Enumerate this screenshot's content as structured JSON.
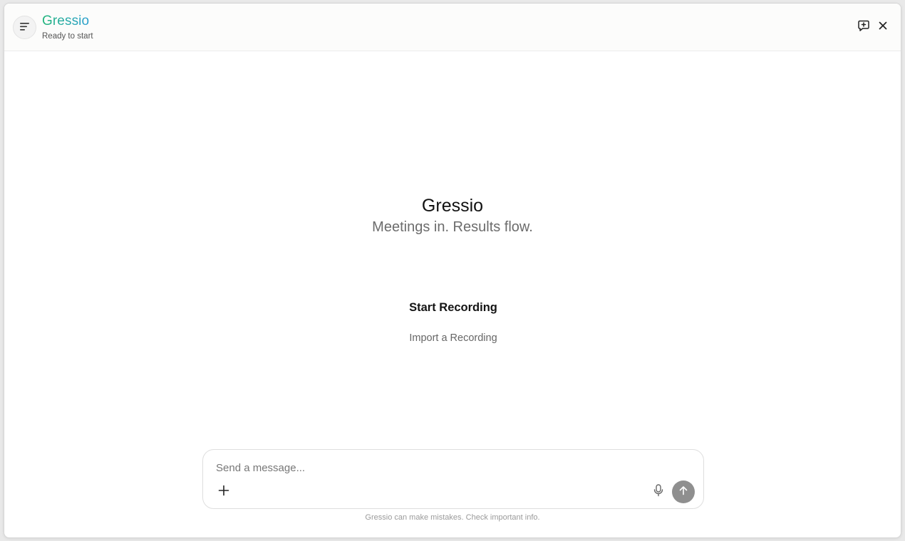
{
  "header": {
    "app_name": "Gressio",
    "status": "Ready to start",
    "icons": {
      "menu": "menu-icon",
      "new_chat": "new-chat-icon",
      "close": "close-icon"
    }
  },
  "hero": {
    "title": "Gressio",
    "tagline": "Meetings in. Results flow."
  },
  "actions": {
    "start_recording": "Start Recording",
    "import_recording": "Import a Recording"
  },
  "composer": {
    "placeholder": "Send a message...",
    "value": "",
    "icons": {
      "attach": "plus-icon",
      "mic": "microphone-icon",
      "send": "arrow-up-icon"
    }
  },
  "footer": {
    "disclaimer": "Gressio can make mistakes. Check important info."
  },
  "colors": {
    "brand_gradient_start": "#21b57a",
    "brand_gradient_end": "#2b9fd0",
    "send_button": "#8f8f8f"
  }
}
